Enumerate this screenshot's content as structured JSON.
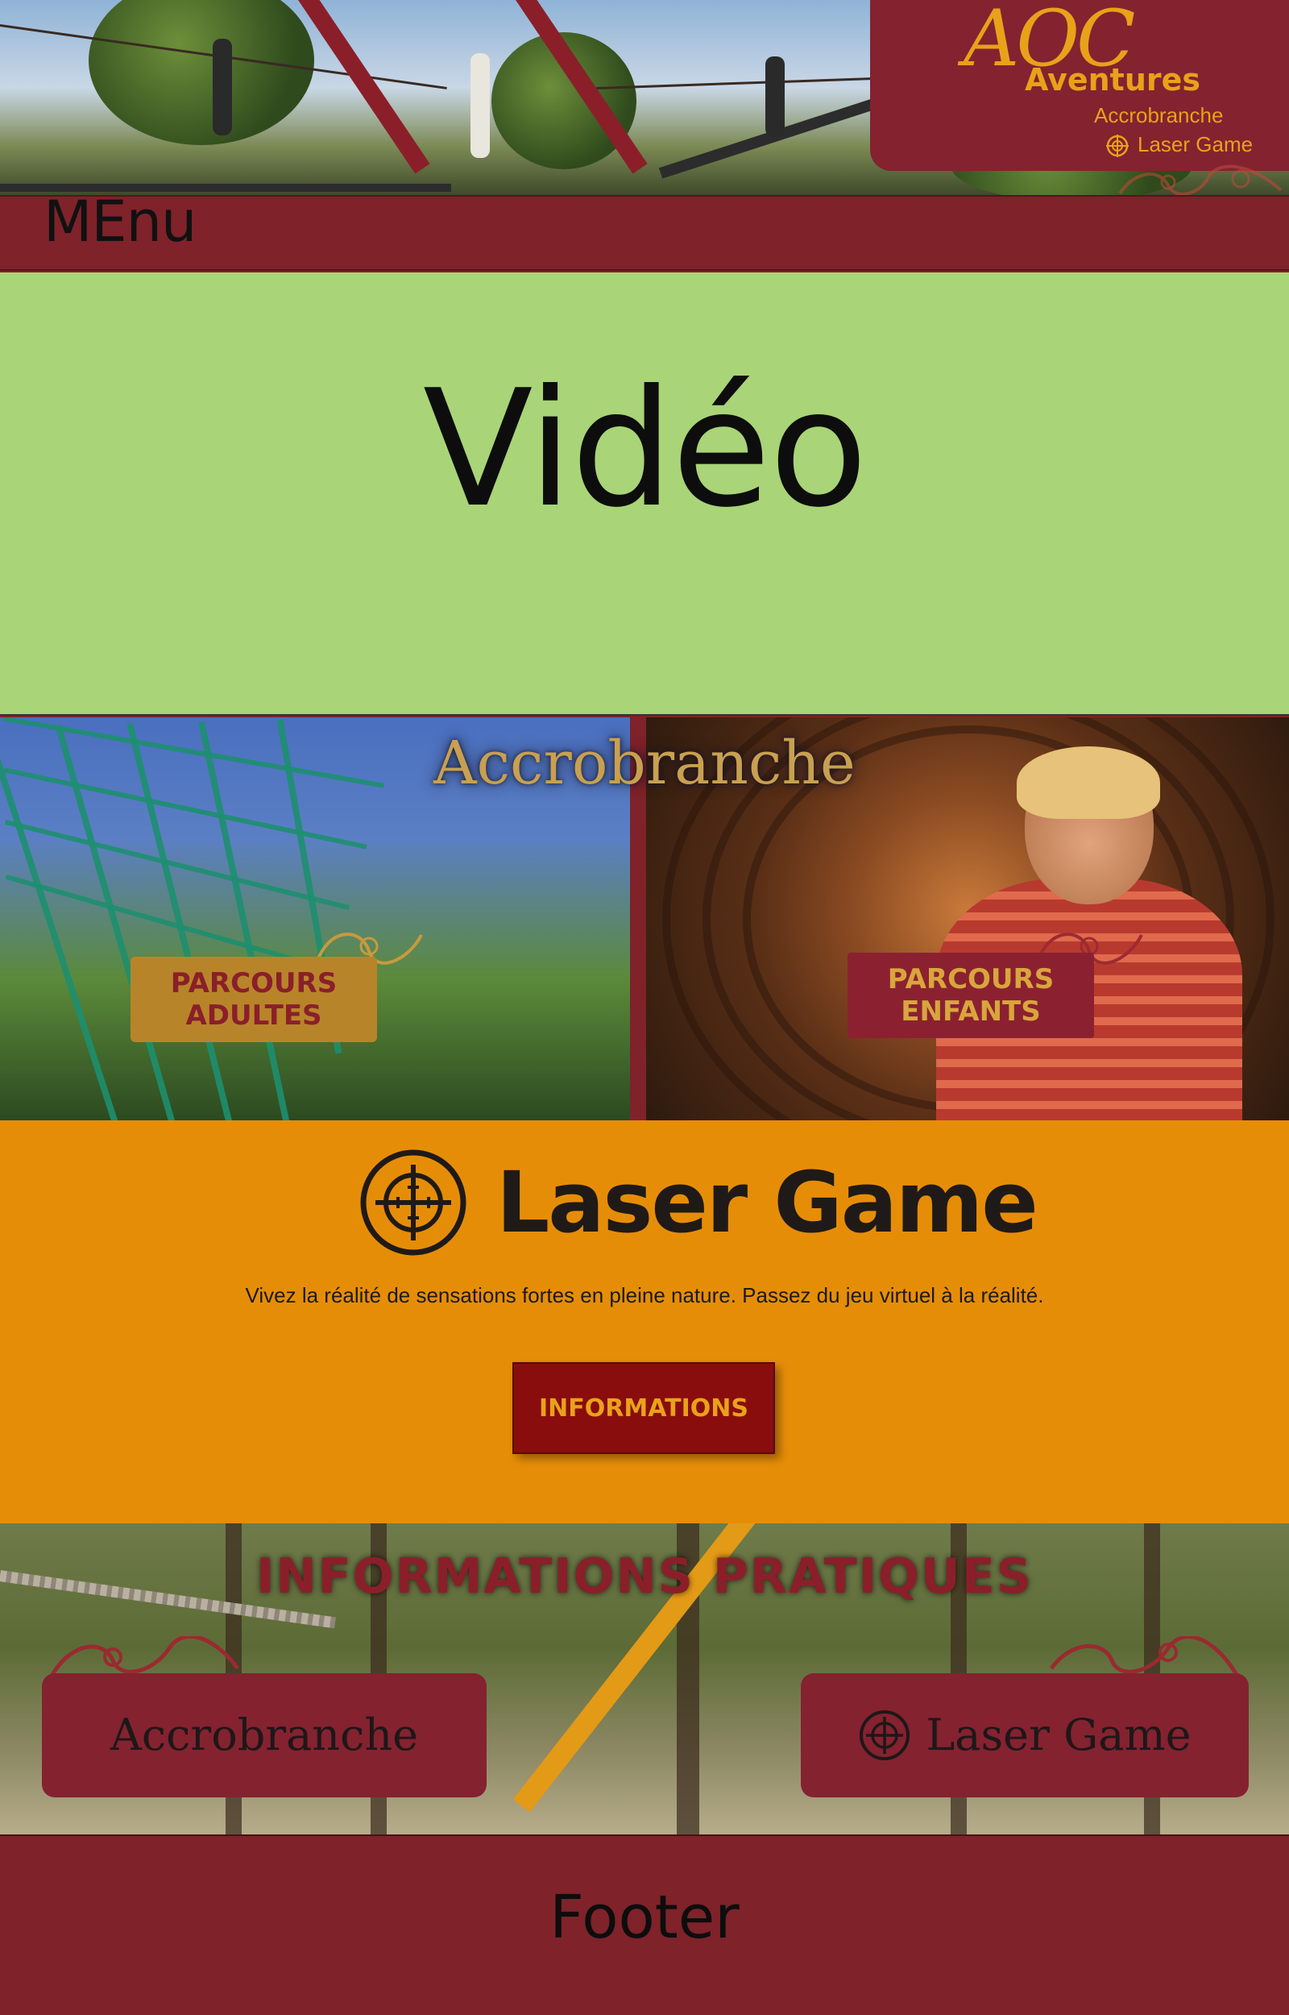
{
  "header": {
    "logo": {
      "brand": "AOC",
      "wordmark": "Aventures",
      "line1": "Accrobranche",
      "line2": "Laser Game",
      "icon": "target-icon",
      "color": "#e8a21a"
    },
    "menu_label": "MEnu",
    "bar_color": "#7f222a"
  },
  "video": {
    "label": "Vidéo",
    "background": "#a9d477"
  },
  "accrobranche": {
    "title": "Accrobranche",
    "adultes_label_line1": "PARCOURS",
    "adultes_label_line2": "ADULTES",
    "enfants_label_line1": "PARCOURS",
    "enfants_label_line2": "ENFANTS"
  },
  "laser": {
    "title": "Laser Game",
    "icon": "crosshair-icon",
    "description": "Vivez la réalité de sensations fortes en pleine nature. Passez du jeu virtuel à la réalité.",
    "button_label": "INFORMATIONS",
    "background": "#e68d08"
  },
  "infos": {
    "title": "INFORMATIONS PRATIQUES",
    "card_accro_label": "Accrobranche",
    "card_laser_label": "Laser Game",
    "card_laser_icon": "crosshair-icon"
  },
  "footer": {
    "label": "Footer"
  }
}
